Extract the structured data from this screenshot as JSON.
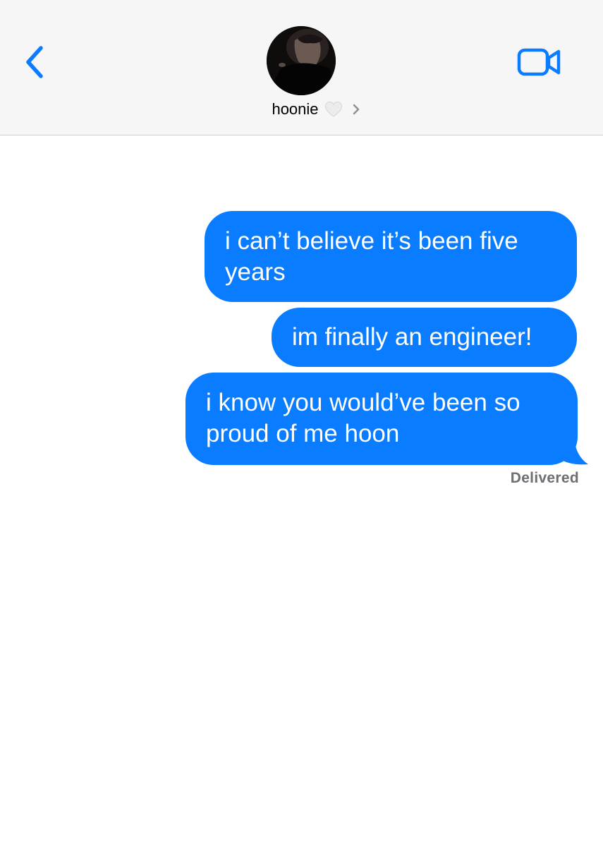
{
  "header": {
    "back_icon": "chevron-left-icon",
    "video_icon": "video-camera-icon",
    "contact_name": "hoonie",
    "heart_icon": "white-heart-icon",
    "chevron_icon": "chevron-right-icon"
  },
  "messages": [
    {
      "text": "i can’t believe it’s been five years",
      "direction": "outgoing"
    },
    {
      "text": "im finally an engineer!",
      "direction": "outgoing"
    },
    {
      "text": "i know you would’ve been so proud of me hoon",
      "direction": "outgoing"
    }
  ],
  "status": "Delivered",
  "colors": {
    "accent": "#0a7cff",
    "header_bg": "#f6f6f6",
    "status_text": "#6e6e73"
  }
}
